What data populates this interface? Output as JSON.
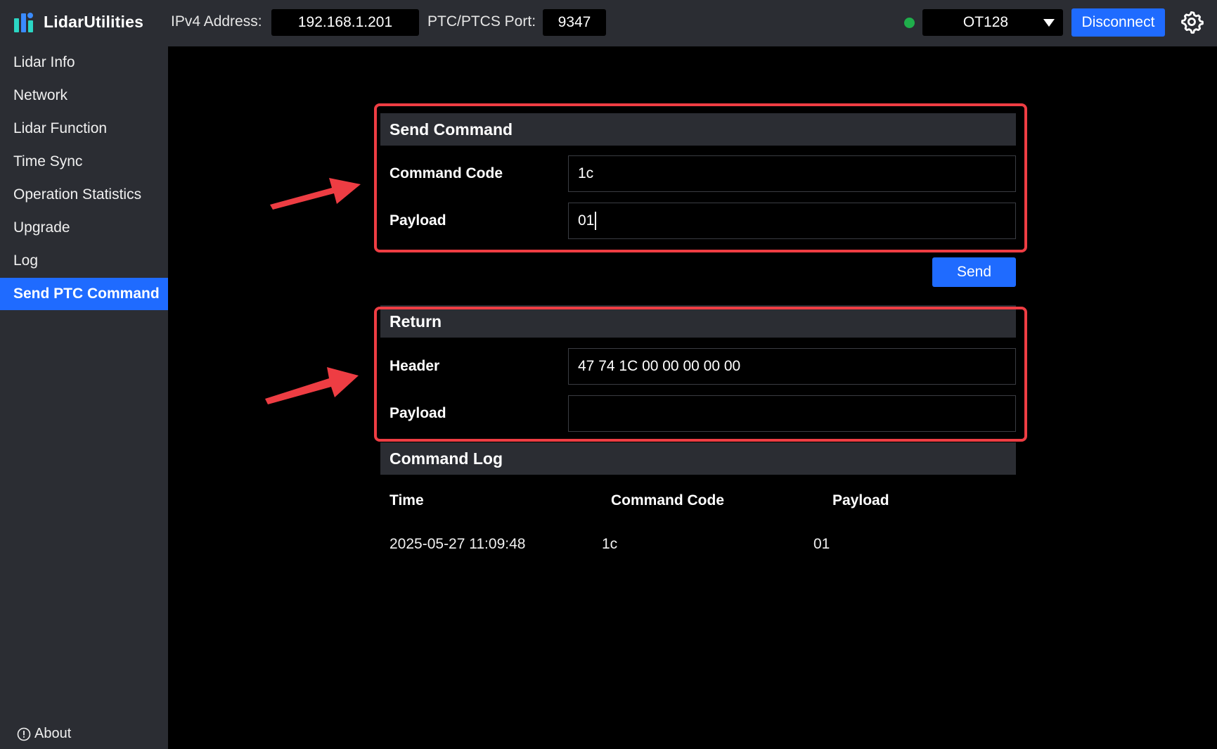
{
  "topbar": {
    "app_title": "LidarUtilities",
    "ipv4_label": "IPv4 Address:",
    "ipv4_value": "192.168.1.201",
    "port_label": "PTC/PTCS Port:",
    "port_value": "9347",
    "model_value": "OT128",
    "disconnect_label": "Disconnect",
    "status_color": "#1fae4b",
    "accent_color": "#1f6bff"
  },
  "sidebar": {
    "items": [
      {
        "label": "Lidar Info"
      },
      {
        "label": "Network"
      },
      {
        "label": "Lidar Function"
      },
      {
        "label": "Time Sync"
      },
      {
        "label": "Operation Statistics"
      },
      {
        "label": "Upgrade"
      },
      {
        "label": "Log"
      },
      {
        "label": "Send PTC Command"
      }
    ],
    "active_index": 7,
    "about_label": "About"
  },
  "send_command": {
    "title": "Send Command",
    "command_code_label": "Command Code",
    "command_code_value": "1c",
    "payload_label": "Payload",
    "payload_value": "01",
    "send_label": "Send"
  },
  "return": {
    "title": "Return",
    "header_label": "Header",
    "header_value": "47 74 1C 00 00 00 00 00",
    "payload_label": "Payload",
    "payload_value": ""
  },
  "command_log": {
    "title": "Command Log",
    "columns": [
      "Time",
      "Command Code",
      "Payload"
    ],
    "rows": [
      [
        "2025-05-27 11:09:48",
        "1c",
        "01"
      ]
    ]
  },
  "annotations": {
    "highlight_color": "#ee3d43"
  }
}
